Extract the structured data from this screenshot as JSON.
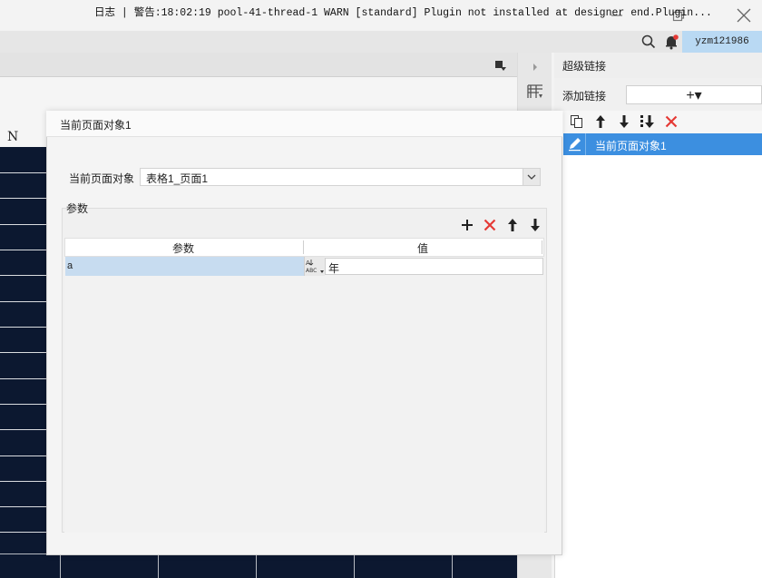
{
  "window": {
    "minimize_glyph": "—",
    "restore_glyph": "❐",
    "close_glyph": "✕"
  },
  "logbar": {
    "text": "日志 | 警告:18:02:19 pool-41-thread-1 WARN [standard] Plugin not installed at designer end.Plugin...",
    "user": "yzm121986"
  },
  "left_panel": {
    "column_header": "N"
  },
  "right_panel": {
    "title": "超级链接",
    "add_label": "添加链接",
    "add_button": "+▾",
    "items": [
      {
        "label": "当前页面对象1"
      }
    ]
  },
  "dialog": {
    "title": "当前页面对象1",
    "object_label": "当前页面对象",
    "object_value": "表格1_页面1",
    "params_group_label": "参数",
    "table": {
      "columns": [
        "参数",
        "值"
      ],
      "rows": [
        {
          "name": "a",
          "type_icon": "ABC",
          "value": "年"
        }
      ]
    }
  },
  "colors": {
    "accent": "#3c8fe0",
    "user_box": "#b9d9f3",
    "grid_bg": "#0c1830",
    "delete_red": "#e53935",
    "selected_row": "#c7dcf0"
  }
}
